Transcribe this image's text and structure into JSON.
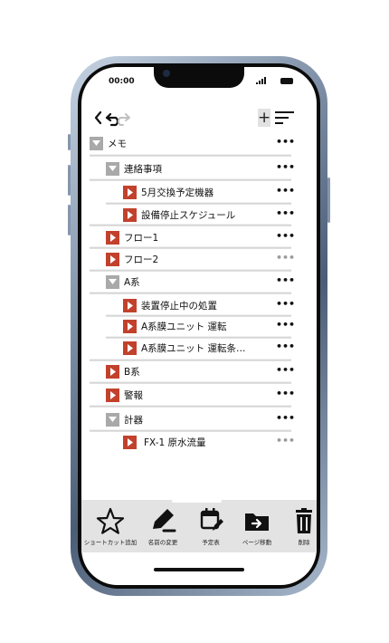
{
  "status_bar": {
    "time": "00:00"
  },
  "nav": {
    "plus_label": "+"
  },
  "tree": [
    {
      "label": "メモ",
      "icon": "folder-open-icon",
      "more": "•••"
    },
    {
      "label": "連絡事項",
      "icon": "folder-open-icon",
      "more": "•••"
    },
    {
      "label": "5月交換予定機器",
      "icon": "page-icon",
      "more": "•••"
    },
    {
      "label": "設備停止スケジュール",
      "icon": "page-icon",
      "more": "•••"
    },
    {
      "label": "フロー1",
      "icon": "page-icon",
      "more": "•••"
    },
    {
      "label": "フロー2",
      "icon": "page-icon",
      "more": "•••"
    },
    {
      "label": "A系",
      "icon": "folder-open-icon",
      "more": "•••"
    },
    {
      "label": "装置停止中の処置",
      "icon": "page-icon",
      "more": "•••"
    },
    {
      "label": "A系膜ユニット 運転",
      "icon": "page-icon",
      "more": "•••"
    },
    {
      "label": "A系膜ユニット 運転条…",
      "icon": "page-icon",
      "more": "•••"
    },
    {
      "label": "B系",
      "icon": "page-icon",
      "more": "•••"
    },
    {
      "label": "警報",
      "icon": "page-icon",
      "more": "•••"
    },
    {
      "label": "計器",
      "icon": "folder-open-icon",
      "more": "•••"
    },
    {
      "label": "FX-1 原水流量",
      "icon": "page-icon",
      "more": "•••"
    }
  ],
  "toolbar": {
    "shortcut_label": "ショートカット追加",
    "rename_label": "名前の変更",
    "schedule_label": "予定表",
    "move_label": "ページ移動",
    "delete_label": "削除"
  },
  "colors": {
    "page_icon": "#c2412c",
    "folder_icon": "#a9a9a9",
    "toolbar_bg": "#e3e3e3"
  }
}
